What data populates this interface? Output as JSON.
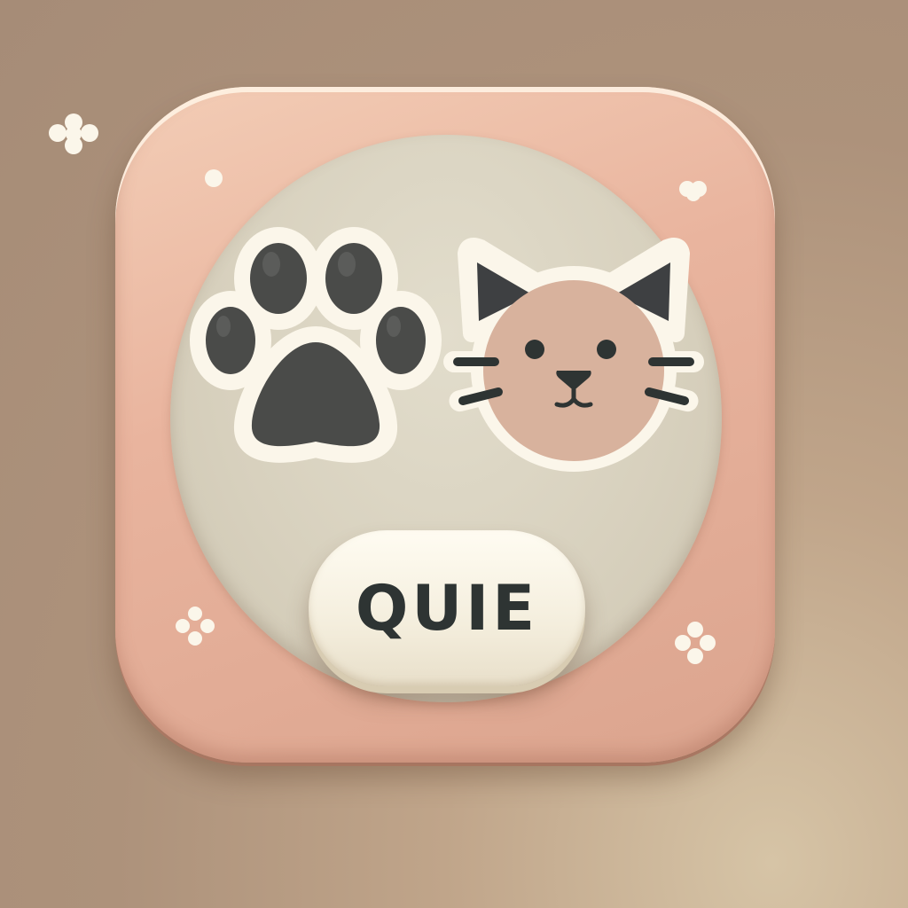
{
  "app_icon": {
    "button_label": "QUIE",
    "icons": {
      "paw": "paw-print-icon",
      "cat": "cat-face-icon",
      "sparkle": "sparkle-icon"
    }
  },
  "colors": {
    "background": "#ad927b",
    "tile": "#e9b49e",
    "disc": "#d7d0bd",
    "button": "#f4eedd",
    "ink": "#2e3433",
    "cat_fur": "#d8b29d",
    "outline": "#fbf6ea"
  }
}
